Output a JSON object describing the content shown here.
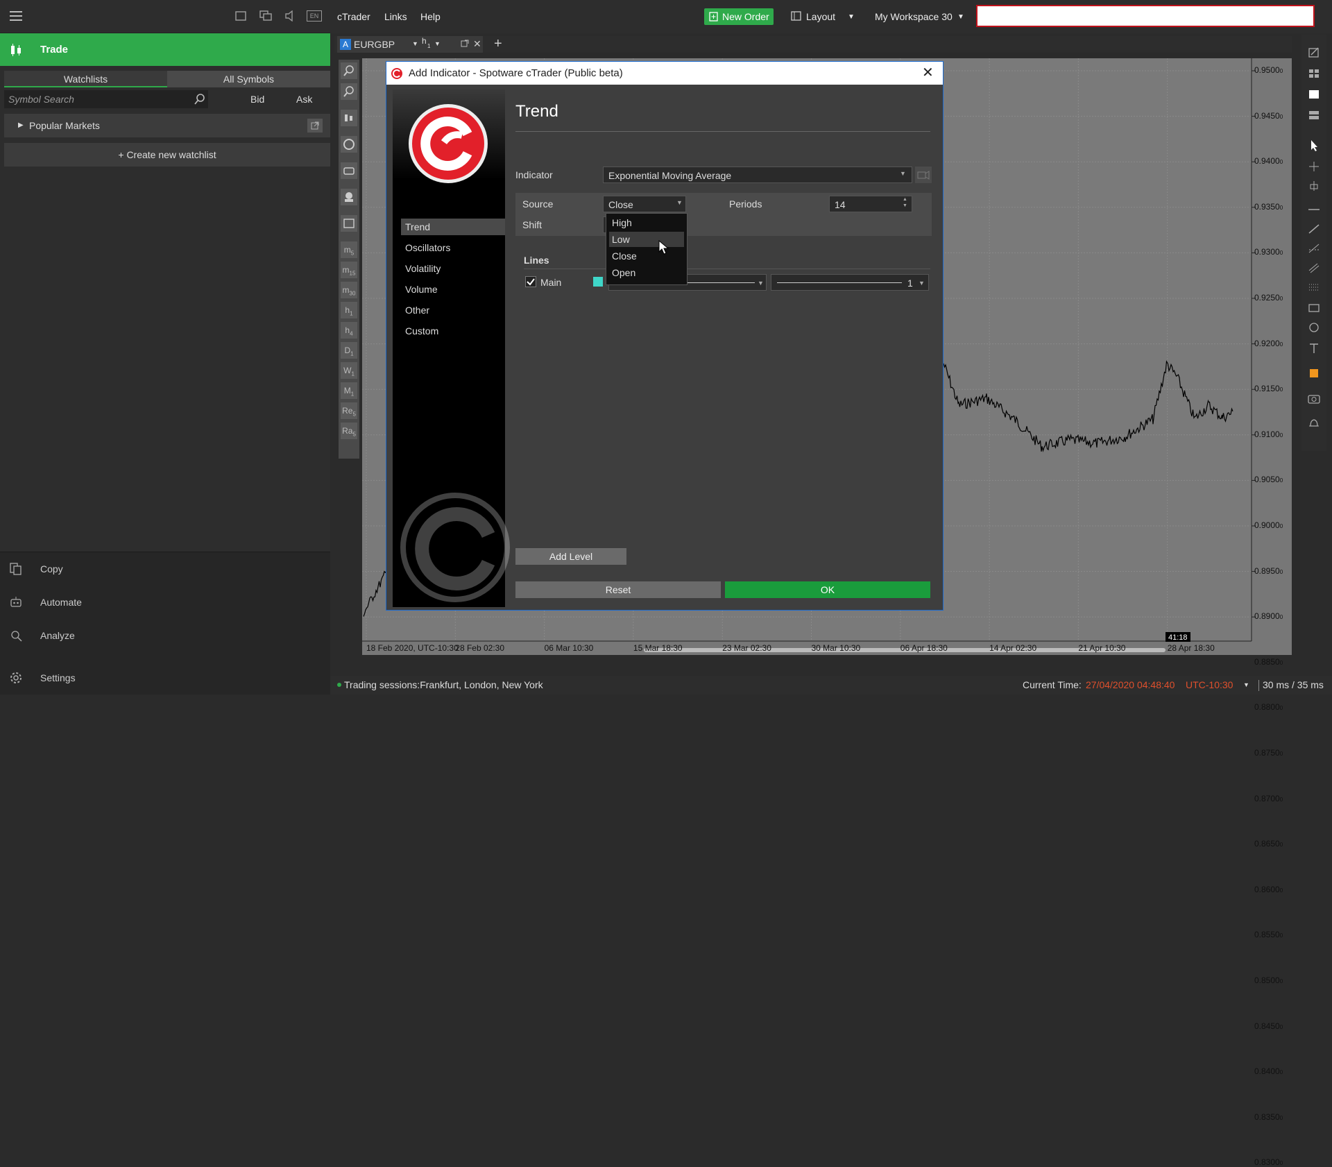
{
  "left": {
    "trade_label": "Trade",
    "tabs": [
      "Watchlists",
      "All Symbols"
    ],
    "search_placeholder": "Symbol Search",
    "bid_label": "Bid",
    "ask_label": "Ask",
    "group_label": "Popular Markets",
    "create_watchlist": "+ Create new watchlist",
    "lang_badge": "EN",
    "bottom_nav": [
      "Copy",
      "Automate",
      "Analyze",
      "Settings"
    ]
  },
  "header": {
    "menus": [
      "cTrader",
      "Links",
      "Help"
    ],
    "new_order": "New Order",
    "layout": "Layout",
    "workspace": "My Workspace 30",
    "search_value": ""
  },
  "chart_tab": {
    "symbol": "EURGBP",
    "badge": "A",
    "timeframe": "h",
    "timeframe_sub": "1"
  },
  "timeframes": [
    {
      "main": "m",
      "sub": "5"
    },
    {
      "main": "m",
      "sub": "15"
    },
    {
      "main": "m",
      "sub": "30"
    },
    {
      "main": "h",
      "sub": "1"
    },
    {
      "main": "h",
      "sub": "4"
    },
    {
      "main": "D",
      "sub": "1"
    },
    {
      "main": "W",
      "sub": "1"
    },
    {
      "main": "M",
      "sub": "1"
    },
    {
      "main": "Re",
      "sub": "5"
    },
    {
      "main": "Ra",
      "sub": "5"
    }
  ],
  "chart": {
    "price_labels": [
      "0.9500",
      "0.9450",
      "0.9400",
      "0.9350",
      "0.9300",
      "0.9250",
      "0.9200",
      "0.9150",
      "0.9100",
      "0.9050",
      "0.9000",
      "0.8950",
      "0.8900",
      "0.8850",
      "0.8800",
      "0.8750",
      "0.8700",
      "0.8650",
      "0.8600",
      "0.8550",
      "0.8500",
      "0.8450",
      "0.8400",
      "0.8350",
      "0.8300"
    ],
    "price_suffix": "0",
    "date_labels": [
      "18 Feb 2020, UTC-10:30",
      "28 Feb 02:30",
      "06 Mar 10:30",
      "15 Mar 18:30",
      "23 Mar 02:30",
      "30 Mar 10:30",
      "06 Apr 18:30",
      "14 Apr 02:30",
      "21 Apr 10:30",
      "28 Apr 18:30"
    ],
    "countdown": "41:18"
  },
  "status": {
    "sessions": "Trading sessions:Frankfurt, London, New York",
    "current_time_label": "Current Time:",
    "current_time": "27/04/2020 04:48:40",
    "timezone": "UTC-10:30",
    "latency": "30 ms / 35 ms"
  },
  "dialog": {
    "title": "Add Indicator - Spotware cTrader (Public beta)",
    "heading": "Trend",
    "categories": [
      "Trend",
      "Oscillators",
      "Volatility",
      "Volume",
      "Other",
      "Custom"
    ],
    "indicator_label": "Indicator",
    "indicator_value": "Exponential Moving Average",
    "source_label": "Source",
    "source_value": "Close",
    "periods_label": "Periods",
    "periods_value": "14",
    "shift_label": "Shift",
    "source_options": [
      "High",
      "Low",
      "Close",
      "Open"
    ],
    "lines_label": "Lines",
    "main_line_label": "Main",
    "thickness_value": "1",
    "line_color": "#3fd6c8",
    "add_level": "Add Level",
    "reset": "Reset",
    "ok": "OK"
  },
  "colors": {
    "accent_green": "#2faa4b",
    "alert_red": "#c0121b",
    "time_red": "#e0502d"
  }
}
